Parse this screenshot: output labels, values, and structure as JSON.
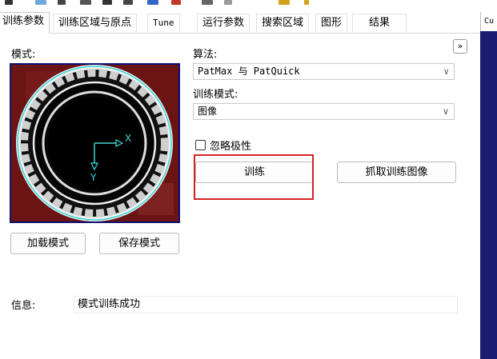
{
  "toolbar": {
    "icons": [
      "arrow-icon",
      "select-icon",
      "copy-icon",
      "folder-icon",
      "save-icon",
      "lock-icon",
      "line-icon",
      "red-icon",
      "grid-icon",
      "play-icon",
      "chart-icon",
      "bulb-icon"
    ]
  },
  "tabs": [
    "训练参数",
    "训练区域与原点",
    "Tune",
    "运行参数",
    "搜索区域",
    "图形",
    "结果"
  ],
  "right_panel": {
    "tab_label": "Cu"
  },
  "pattern": {
    "label": "模式:",
    "axis_x": "X",
    "axis_y": "Y"
  },
  "algorithm": {
    "label": "算法:",
    "value": "PatMax 与 PatQuick"
  },
  "train_mode": {
    "label": "训练模式:",
    "value": "图像"
  },
  "ignore_polarity": {
    "label": "忽略极性",
    "checked": false
  },
  "buttons": {
    "train": "训练",
    "grab_train_image": "抓取训练图像",
    "load_pattern": "加载模式",
    "save_pattern": "保存模式"
  },
  "info": {
    "label": "信息:",
    "value": "模式训练成功"
  },
  "colors": {
    "accent_red": "#d12424",
    "right_panel": "#1b1b6f",
    "pattern_bg": "#6b1414"
  }
}
